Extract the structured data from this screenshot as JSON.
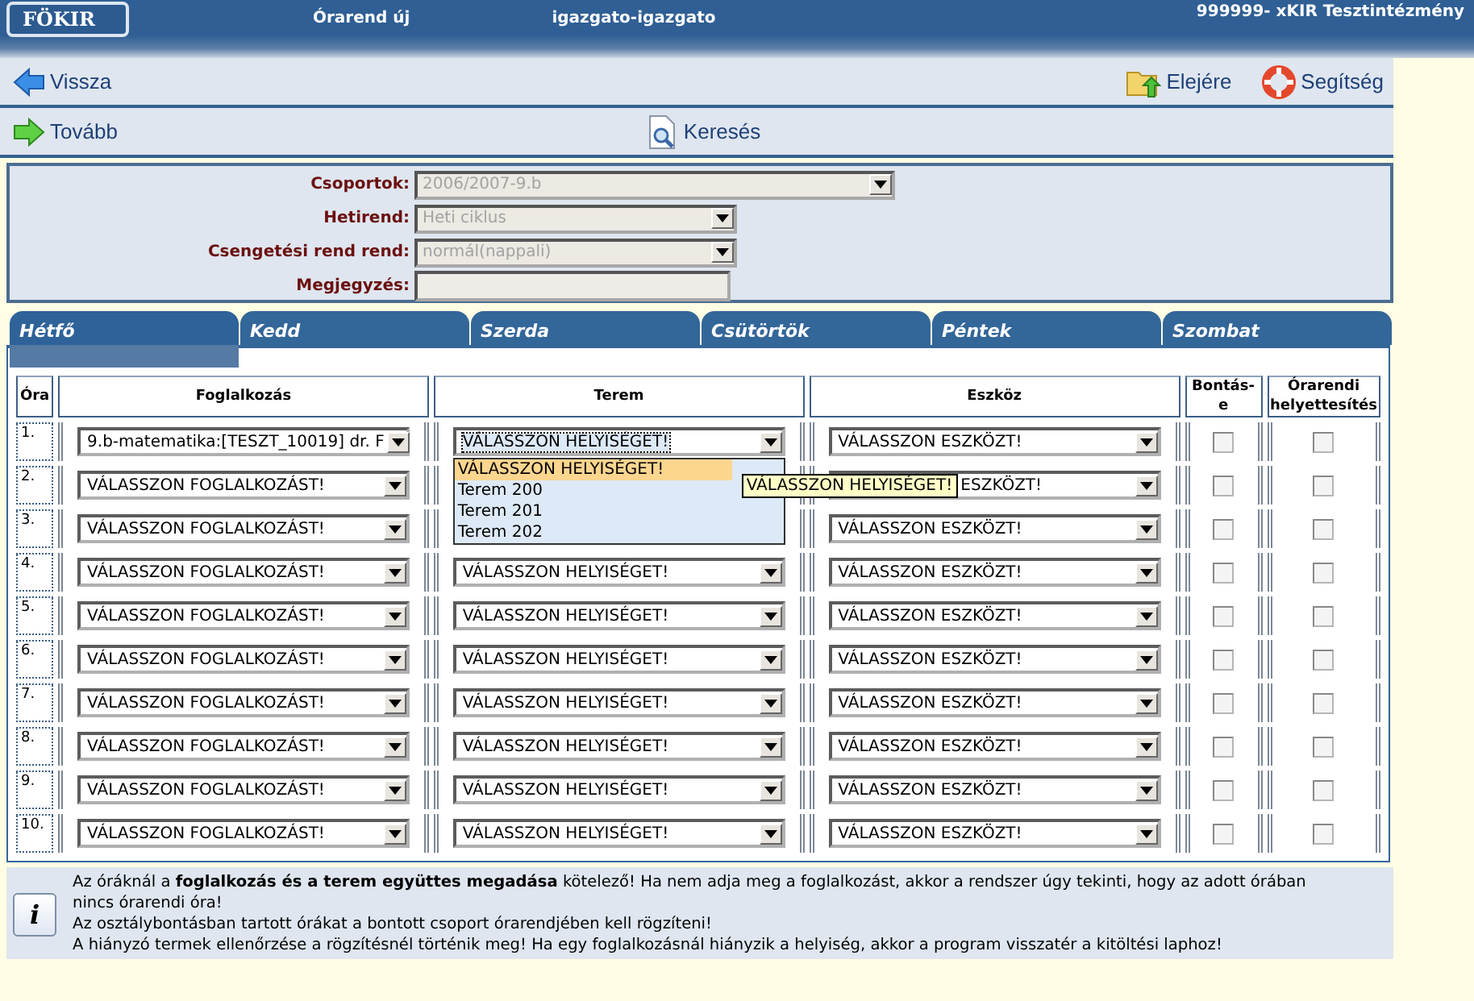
{
  "header": {
    "logo": "FÖKIR",
    "title": "Órarend új",
    "user": "igazgato-igazgato",
    "institution": "999999- xKIR Tesztintézmény"
  },
  "toolbars": [
    [
      {
        "kind": "back",
        "label": "Vissza"
      },
      {
        "kind": "home",
        "label": "Elejére"
      },
      {
        "kind": "help",
        "label": "Segítség"
      }
    ],
    [
      {
        "kind": "forward",
        "label": "Tovább"
      },
      {
        "kind": "search",
        "label": "Keresés"
      }
    ]
  ],
  "form": [
    {
      "label": "Csoportok:",
      "kind": "wide-select",
      "value": "2006/2007-9.b"
    },
    {
      "label": "Hetirend:",
      "kind": "select",
      "value": "Heti ciklus"
    },
    {
      "label": "Csengetési rend rend:",
      "kind": "select",
      "value": "normál(nappali)"
    },
    {
      "label": "Megjegyzés:",
      "kind": "text"
    }
  ],
  "tabs": [
    {
      "label": "Hétfő",
      "selected": true
    },
    {
      "label": "Kedd",
      "selected": false
    },
    {
      "label": "Szerda",
      "selected": false
    },
    {
      "label": "Csütörtök",
      "selected": false
    },
    {
      "label": "Péntek",
      "selected": false
    },
    {
      "label": "Szombat",
      "selected": false
    }
  ],
  "table": {
    "columns": [
      "Óra",
      "Foglalkozás",
      "Terem",
      "Eszköz",
      "Bontás-e",
      "Órarendi helyettesítés"
    ],
    "rows": [
      {
        "number": "1.",
        "activity": "9.b-matematika:[TESZT_10019] dr. F",
        "room": "VÁLASSZON HELYISÉGET!",
        "device": "VÁLASSZON ESZKÖZT!",
        "split": false,
        "substitution": false
      },
      {
        "number": "2.",
        "activity": "VÁLASSZON FOGLALKOZÁST!",
        "device": "ESZKÖZT!",
        "split": false,
        "substitution": false
      },
      {
        "number": "3.",
        "activity": "VÁLASSZON FOGLALKOZÁST!",
        "device": "VÁLASSZON ESZKÖZT!",
        "split": false,
        "substitution": false
      },
      {
        "number": "4.",
        "activity": "VÁLASSZON FOGLALKOZÁST!",
        "room": "VÁLASSZON HELYISÉGET!",
        "device": "VÁLASSZON ESZKÖZT!",
        "split": false,
        "substitution": false
      },
      {
        "number": "5.",
        "activity": "VÁLASSZON FOGLALKOZÁST!",
        "room": "VÁLASSZON HELYISÉGET!",
        "device": "VÁLASSZON ESZKÖZT!",
        "split": false,
        "substitution": false
      },
      {
        "number": "6.",
        "activity": "VÁLASSZON FOGLALKOZÁST!",
        "room": "VÁLASSZON HELYISÉGET!",
        "device": "VÁLASSZON ESZKÖZT!",
        "split": false,
        "substitution": false
      },
      {
        "number": "7.",
        "activity": "VÁLASSZON FOGLALKOZÁST!",
        "room": "VÁLASSZON HELYISÉGET!",
        "device": "VÁLASSZON ESZKÖZT!",
        "split": false,
        "substitution": false
      },
      {
        "number": "8.",
        "activity": "VÁLASSZON FOGLALKOZÁST!",
        "room": "VÁLASSZON HELYISÉGET!",
        "device": "VÁLASSZON ESZKÖZT!",
        "split": false,
        "substitution": false
      },
      {
        "number": "9.",
        "activity": "VÁLASSZON FOGLALKOZÁST!",
        "room": "VÁLASSZON HELYISÉGET!",
        "device": "VÁLASSZON ESZKÖZT!",
        "split": false,
        "substitution": false
      },
      {
        "number": "10.",
        "activity": "VÁLASSZON FOGLALKOZÁST!",
        "room": "VÁLASSZON HELYISÉGET!",
        "device": "VÁLASSZON ESZKÖZT!",
        "split": false,
        "substitution": false
      }
    ]
  },
  "room_dropdown": {
    "options": [
      {
        "label": "VÁLASSZON HELYISÉGET!",
        "selected": true
      },
      {
        "label": "Terem 200",
        "selected": false
      },
      {
        "label": "Terem 201",
        "selected": false
      },
      {
        "label": "Terem 202",
        "selected": false
      }
    ],
    "tooltip": "VÁLASSZON HELYISÉGET!"
  },
  "info": {
    "icon": "i",
    "lines": [
      "Az óráknál a **foglalkozás és a terem együttes megadása** kötelező! Ha nem adja meg a foglalkozást, akkor a rendszer úgy tekinti, hogy az adott órában nincs órarendi óra!",
      "Az osztálybontásban tartott órákat a bontott csoport órarendjében kell rögzíteni!",
      "A hiányzó termek ellenőrzése a rögzítésnél történik meg! Ha egy foglalkozásnál hiányzik a helyiség, akkor a program visszatér a kitöltési laphoz!"
    ]
  }
}
